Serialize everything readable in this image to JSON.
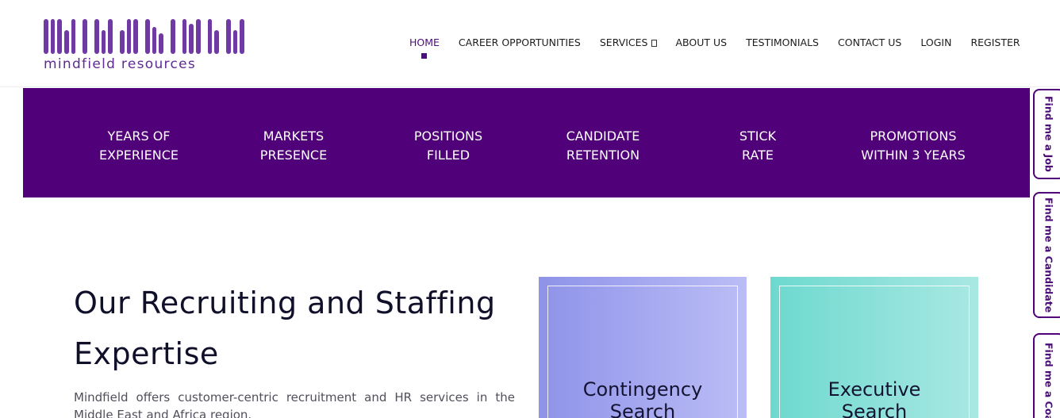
{
  "logo": {
    "wordmark": "Mindfield",
    "subtitle": "mindfield resources",
    "color": "#6f3aa3"
  },
  "nav": {
    "items": [
      {
        "label": "HOME",
        "active": true
      },
      {
        "label": "CAREER OPPORTUNITIES",
        "active": false
      },
      {
        "label": "SERVICES",
        "active": false,
        "has_dropdown": true
      },
      {
        "label": "ABOUT US",
        "active": false
      },
      {
        "label": "TESTIMONIALS",
        "active": false
      },
      {
        "label": "CONTACT US",
        "active": false
      },
      {
        "label": "LOGIN",
        "active": false
      },
      {
        "label": "REGISTER",
        "active": false
      }
    ]
  },
  "stats": [
    {
      "line1": "YEARS OF",
      "line2": "EXPERIENCE"
    },
    {
      "line1": "MARKETS",
      "line2": "PRESENCE"
    },
    {
      "line1": "POSITIONS",
      "line2": "FILLED"
    },
    {
      "line1": "CANDIDATE",
      "line2": "RETENTION"
    },
    {
      "line1": "STICK",
      "line2": "RATE"
    },
    {
      "line1": "PROMOTIONS",
      "line2": "WITHIN 3 YEARS"
    }
  ],
  "side_tabs": [
    {
      "label": "Find me a Job"
    },
    {
      "label": "Find me a Candidate"
    },
    {
      "label": "Find me a Coach"
    }
  ],
  "main": {
    "heading_line1": "Our Recruiting and Staffing",
    "heading_line2": "Expertise",
    "paragraph": "Mindfield offers customer-centric recruitment and HR services in the Middle East and Africa region."
  },
  "cards": [
    {
      "line1": "Contingency",
      "line2": "Search"
    },
    {
      "line1": "Executive",
      "line2": "Search"
    }
  ],
  "colors": {
    "brand_purple": "#500079",
    "nav_active": "#4e0b7e",
    "card_1_gradient": [
      "#8f93e8",
      "#bbbdf6"
    ],
    "card_2_gradient": [
      "#6dd9cf",
      "#a9e8e3"
    ]
  }
}
